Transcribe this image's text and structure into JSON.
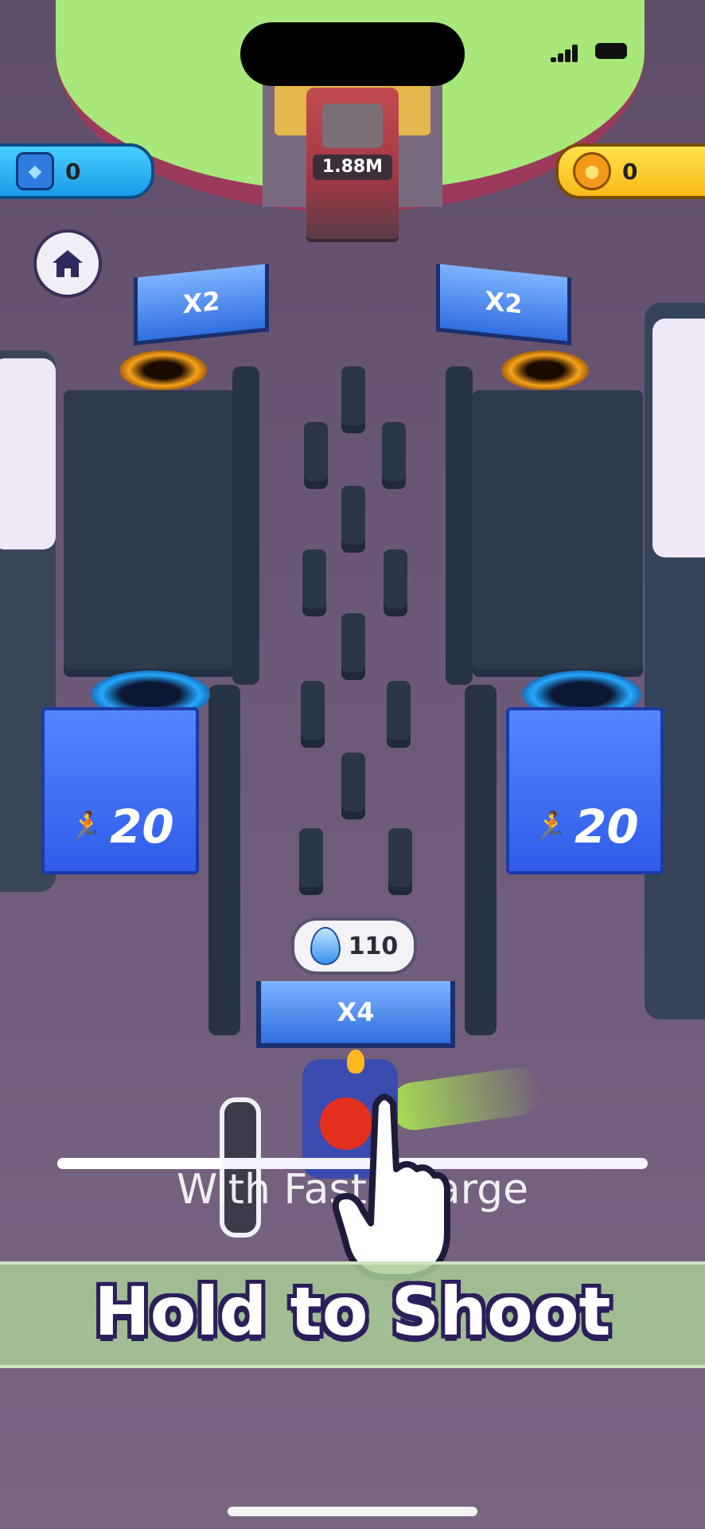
{
  "hud": {
    "gems": {
      "value": "0",
      "icon": "gem-icon"
    },
    "coins": {
      "value": "0",
      "icon": "coin-icon"
    }
  },
  "enemy_tower": {
    "hp_label": "1.88M"
  },
  "gates": {
    "left": "X2",
    "right": "X2",
    "center": "X4"
  },
  "crates": {
    "left": {
      "count": "20",
      "icon": "people-icon"
    },
    "right": {
      "count": "20",
      "icon": "people-icon"
    }
  },
  "cost_bubble": {
    "value": "110",
    "icon": "egg-icon"
  },
  "tutorial": {
    "subtitle": "With Fast Charge",
    "title": "Hold to Shoot"
  },
  "charge": {
    "level": 0.28
  }
}
